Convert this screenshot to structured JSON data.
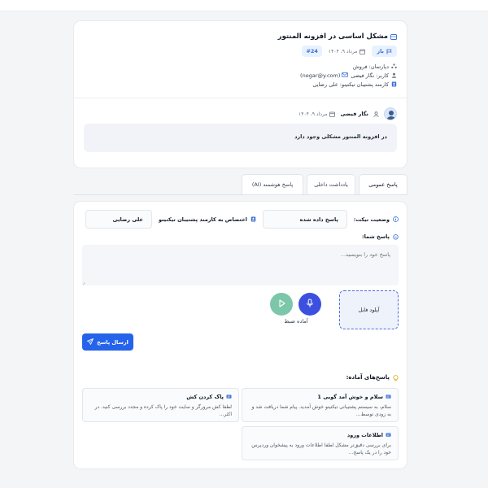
{
  "ticket": {
    "title": "مشکل اساسی در افزونه المنتور",
    "status_badge": "باز",
    "date": "مرداد ۹، ۱۴۰۴",
    "number": "#24",
    "department": "دپارتمان: فروش",
    "user": "کاربر: نگار فیضی",
    "email": "(negar@y.com)",
    "support_staff": "کارمند پشتیبان تیکتینو: علی رضایی"
  },
  "message": {
    "author": "نگار فیضی",
    "date": "مرداد ۹، ۱۴۰۴",
    "body": "در افزونه المنتور مشکلی وجود دارد"
  },
  "tabs": [
    {
      "label": "پاسخ عمومی"
    },
    {
      "label": "یادداشت داخلی"
    },
    {
      "label": "پاسخ هوشمند (AI)"
    }
  ],
  "reply": {
    "status_label": "وضعیت تیکت:",
    "status_value": "پاسخ داده شده",
    "assign_label": "اختصاص به کارمند پشتیبان تیکتینو",
    "assign_value": "علی رضایی",
    "your_reply_label": "پاسخ شما:",
    "placeholder": "پاسخ خود را بنویسید...",
    "upload_label": "آپلود فایل",
    "record_label": "آماده ضبط",
    "send_label": "ارسال پاسخ"
  },
  "quick_replies": {
    "title": "پاسخ‌های آماده:",
    "items": [
      {
        "title": "سلام و خوش آمد گویی 1",
        "body": "سلام، به سیستم پشتیبانی تیکتینو خوش آمدید. پیام شما دریافت شد و به زودی توسط..."
      },
      {
        "title": "پاک کردن کش",
        "body": "لطفا کش مرورگر و سایت خود را پاک کرده و مجدد بررسی کنید. در اکثر..."
      },
      {
        "title": "اطلاعات ورود",
        "body": "برای بررسی دقیق‌تر مشکل لطفا اطلاعات ورود به پیشخوان وردپرس خود را در یک پاسخ..."
      }
    ]
  },
  "colors": {
    "accent": "#2563eb",
    "mic": "#3b4fe0",
    "play": "#7cc7a9",
    "badge_bg": "#e8f1ff"
  }
}
